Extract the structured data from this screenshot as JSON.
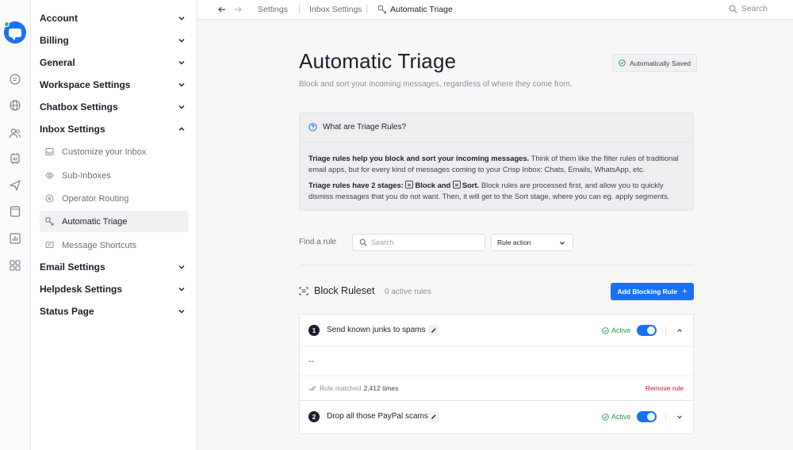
{
  "rail": {
    "items": [
      "logo-icon",
      "chat-icon",
      "globe-icon",
      "contacts-icon",
      "ai-icon",
      "campaigns-icon",
      "helpdesk-icon",
      "analytics-icon",
      "plugins-icon"
    ]
  },
  "sidebar": {
    "groups": [
      {
        "label": "Account"
      },
      {
        "label": "Billing"
      },
      {
        "label": "General"
      },
      {
        "label": "Workspace Settings"
      },
      {
        "label": "Chatbox Settings"
      },
      {
        "label": "Inbox Settings"
      },
      {
        "label": "Email Settings"
      },
      {
        "label": "Helpdesk Settings"
      },
      {
        "label": "Status Page"
      }
    ],
    "inbox_items": [
      {
        "label": "Customize your Inbox"
      },
      {
        "label": "Sub-Inboxes"
      },
      {
        "label": "Operator Routing"
      },
      {
        "label": "Automatic Triage"
      },
      {
        "label": "Message Shortcuts"
      }
    ]
  },
  "topbar": {
    "breadcrumbs": [
      "Settings",
      "Inbox Settings",
      "Automatic Triage"
    ],
    "search_label": "Search"
  },
  "page": {
    "title": "Automatic Triage",
    "subtitle": "Block and sort your incoming messages, regardless of where they come from.",
    "saved_label": "Automatically Saved"
  },
  "info": {
    "heading": "What are Triage Rules?",
    "p1_bold": "Triage rules help you block and sort your incoming messages.",
    "p1_rest": " Think of them like the filter rules of traditional email apps, but for every kind of messages coming to your Crisp Inbox: Chats, Emails, WhatsApp, etc.",
    "p2_bold_a": "Triage rules have 2 stages: ",
    "p2_block": "Block",
    "p2_and": " and ",
    "p2_sort": "Sort.",
    "p2_rest": " Block rules are processed first, and allow you to quickly dismiss messages that you do not want. Then, it will get to the Sort stage, where you can eg. apply segments."
  },
  "filters": {
    "find_label": "Find a rule",
    "search_placeholder": "Search",
    "rule_action_label": "Rule action"
  },
  "ruleset": {
    "title": "Block Ruleset",
    "count": "0 active rules",
    "add_button": "Add Blocking Rule",
    "add_plus": "+"
  },
  "rules": [
    {
      "number": "1",
      "name": "Send known junks to spams",
      "status": "Active",
      "description": "--",
      "matched_prefix": "Rule matched",
      "matched_count": "2,412 times",
      "remove_label": "Remove rule"
    },
    {
      "number": "2",
      "name": "Drop all those PayPal scams",
      "status": "Active"
    }
  ],
  "colors": {
    "accent": "#1972f5",
    "success": "#1e9c4a",
    "danger": "#d0142b"
  }
}
